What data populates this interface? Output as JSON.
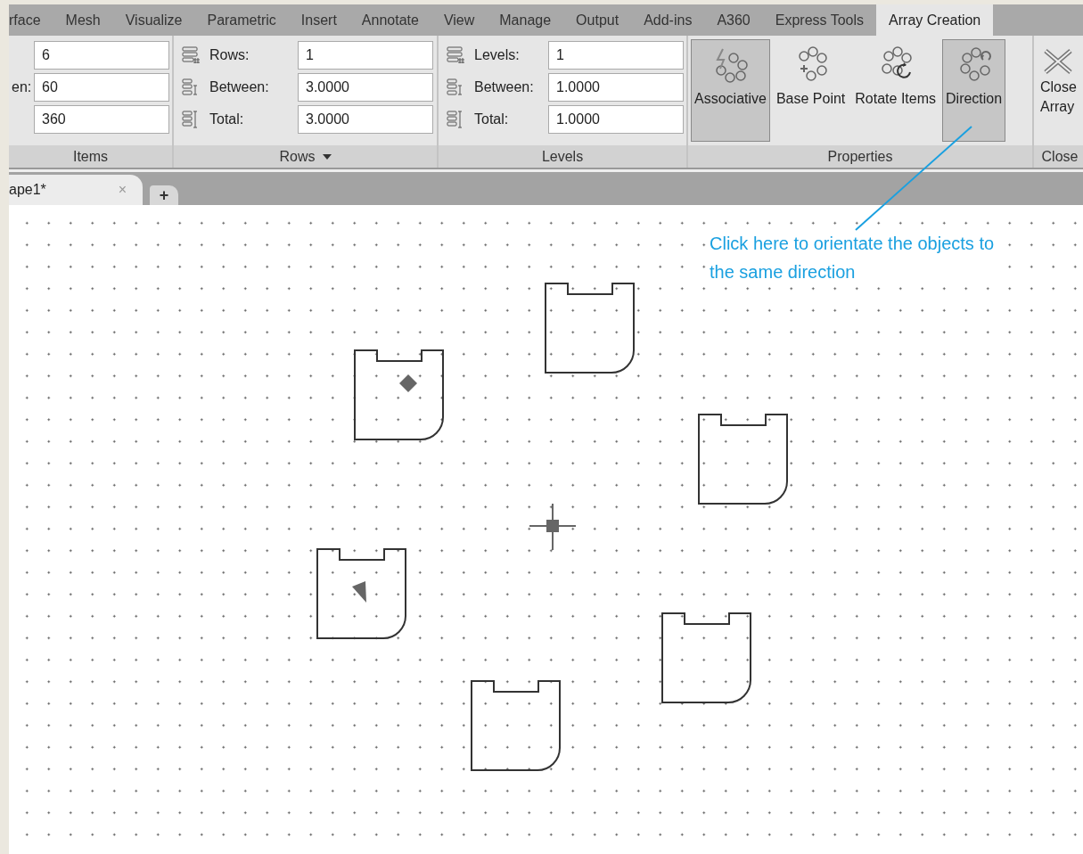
{
  "ribbon_tabs": [
    {
      "label": "rface",
      "selected": false
    },
    {
      "label": "Mesh",
      "selected": false
    },
    {
      "label": "Visualize",
      "selected": false
    },
    {
      "label": "Parametric",
      "selected": false
    },
    {
      "label": "Insert",
      "selected": false
    },
    {
      "label": "Annotate",
      "selected": false
    },
    {
      "label": "View",
      "selected": false
    },
    {
      "label": "Manage",
      "selected": false
    },
    {
      "label": "Output",
      "selected": false
    },
    {
      "label": "Add-ins",
      "selected": false
    },
    {
      "label": "A360",
      "selected": false
    },
    {
      "label": "Express Tools",
      "selected": false
    },
    {
      "label": "Array Creation",
      "selected": true
    }
  ],
  "panels": [
    {
      "kind": "fields",
      "title": "Items",
      "fields": [
        {
          "value": "6"
        },
        {
          "label": "en:",
          "value": "60"
        },
        {
          "value": "360"
        }
      ]
    },
    {
      "kind": "fields",
      "title": "Rows",
      "dropdown": true,
      "fields": [
        {
          "label": "Rows:",
          "value": "1"
        },
        {
          "label": "Between:",
          "value": "3.0000"
        },
        {
          "label": "Total:",
          "value": "3.0000"
        }
      ]
    },
    {
      "kind": "fields",
      "title": "Levels",
      "fields": [
        {
          "label": "Levels:",
          "value": "1"
        },
        {
          "label": "Between:",
          "value": "1.0000"
        },
        {
          "label": "Total:",
          "value": "1.0000"
        }
      ]
    },
    {
      "kind": "buttons",
      "title": "Properties",
      "buttons": [
        {
          "label": "Associative",
          "selected": true
        },
        {
          "label": "Base Point",
          "selected": false
        },
        {
          "label": "Rotate Items",
          "selected": false
        },
        {
          "label": "Direction",
          "selected": true
        }
      ]
    },
    {
      "kind": "close",
      "title": "Close",
      "buttons": [
        {
          "label": "Close Array"
        }
      ]
    }
  ],
  "document_tabs": [
    {
      "label": "ape1*",
      "close": "×"
    }
  ],
  "new_tab": "+",
  "callout": "Click here to orientate the objects to the same direction"
}
